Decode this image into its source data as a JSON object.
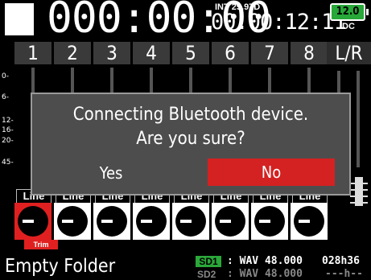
{
  "status_bar": {
    "timecode": "000:00:00",
    "tc_label": "INT 29.97D",
    "tc_value": "00:00:12:11",
    "battery": "12.0",
    "power_source": "DC"
  },
  "channels": [
    "1",
    "2",
    "3",
    "4",
    "5",
    "6",
    "7",
    "8"
  ],
  "lr_label": "L/R",
  "meter_scale": [
    "0-",
    "6-",
    "12-",
    "16-",
    "20-",
    "45-"
  ],
  "inputs": [
    "Line",
    "Line",
    "Line",
    "Line",
    "Line",
    "Line",
    "Line",
    "Line"
  ],
  "trim_label": "Trim",
  "bottom_bar": {
    "folder": "Empty Folder",
    "sd1_label": "SD1",
    "sd1_info": ": WAV 48.000",
    "sd2_label": "SD2",
    "sd2_info": ": WAV 48.000",
    "remaining_1": "028h36",
    "remaining_2": "---h--"
  },
  "dialog": {
    "line1": "Connecting Bluetooth device.",
    "line2": "Are you sure?",
    "yes": "Yes",
    "no": "No"
  },
  "colors": {
    "accent_red": "#d42121",
    "battery_green": "#27a838",
    "sd_green": "#2ba83a"
  }
}
